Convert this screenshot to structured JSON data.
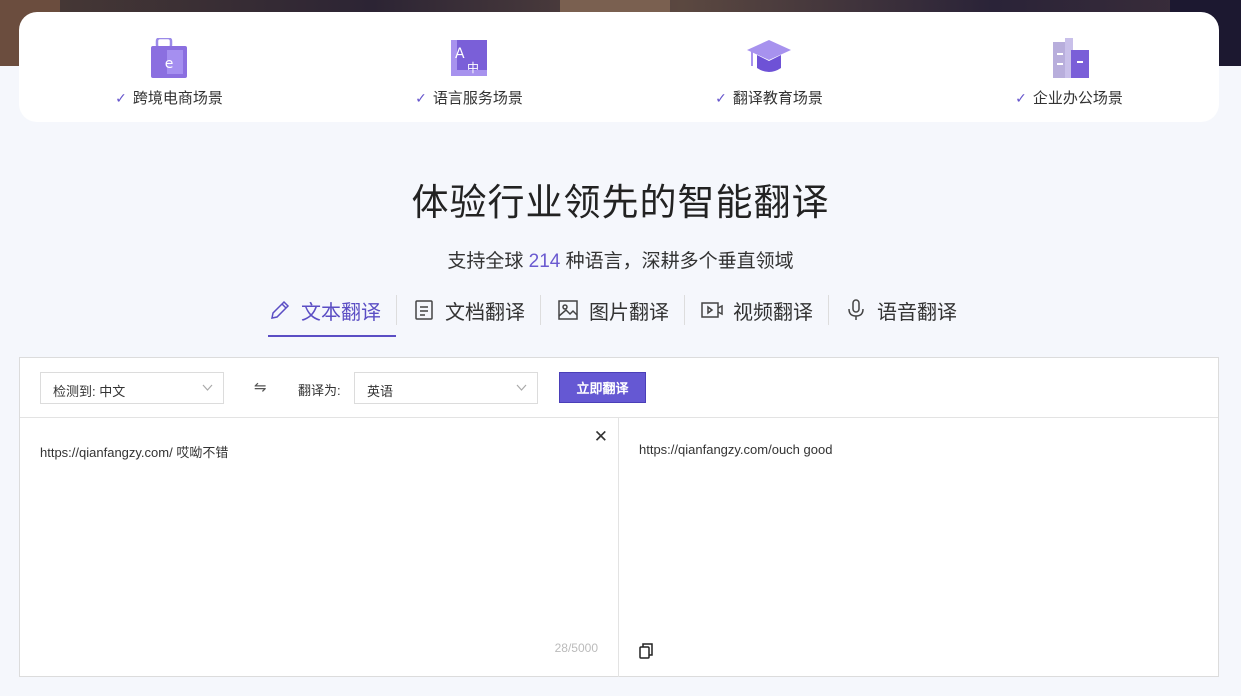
{
  "scenes": [
    {
      "icon": "shopping-bag-icon",
      "label": "跨境电商场景"
    },
    {
      "icon": "language-translate-icon",
      "label": "语言服务场景"
    },
    {
      "icon": "graduation-cap-icon",
      "label": "翻译教育场景"
    },
    {
      "icon": "office-building-icon",
      "label": "企业办公场景"
    }
  ],
  "check_mark": "✓",
  "title": "体验行业领先的智能翻译",
  "subtitle": {
    "prefix": "支持全球 ",
    "number": "214",
    "suffix": " 种语言，深耕多个垂直领域"
  },
  "tabs": [
    {
      "label": "文本翻译",
      "icon": "pencil-icon",
      "active": true
    },
    {
      "label": "文档翻译",
      "icon": "document-icon",
      "active": false
    },
    {
      "label": "图片翻译",
      "icon": "image-icon",
      "active": false
    },
    {
      "label": "视频翻译",
      "icon": "video-icon",
      "active": false
    },
    {
      "label": "语音翻译",
      "icon": "microphone-icon",
      "active": false
    }
  ],
  "translator": {
    "source_lang": "检测到: 中文",
    "swap_symbol": "⇋",
    "target_label": "翻译为:",
    "target_lang": "英语",
    "translate_button": "立即翻译",
    "source_text": "https://qianfangzy.com/ 哎呦不错",
    "clear_symbol": "✕",
    "char_count": "28/5000",
    "result_text": "https://qianfangzy.com/ouch good"
  },
  "colors": {
    "accent": "#6558d3",
    "tab_active": "#5b4ec4",
    "number_highlight": "#6a5ad0"
  }
}
